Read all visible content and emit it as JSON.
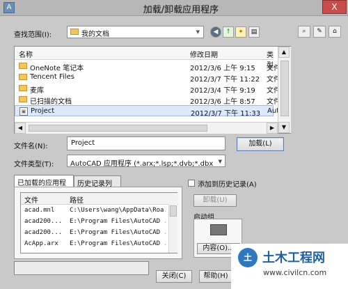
{
  "window": {
    "title": "加载/卸载应用程序",
    "app_icon": "A",
    "close_symbol": "X"
  },
  "search": {
    "label": "查找范围(I):",
    "location": "我的文档"
  },
  "toolbar": {
    "icons": [
      "back-icon",
      "up-folder-icon",
      "new-folder-icon",
      "view-menu-icon",
      "search-icon",
      "tools-icon",
      "help-icon"
    ]
  },
  "file_list": {
    "columns": [
      "名称",
      "修改日期",
      "类型"
    ],
    "items": [
      {
        "name": "OneNote 笔记本",
        "date": "2012/3/6 上午 9:15",
        "type": "文件",
        "icon": "folder"
      },
      {
        "name": "Tencent Files",
        "date": "2012/3/7 下午 11:22",
        "type": "文件",
        "icon": "folder"
      },
      {
        "name": "麦库",
        "date": "2012/3/4 下午 9:19",
        "type": "文件",
        "icon": "folder"
      },
      {
        "name": "已扫描的文档",
        "date": "2012/3/6 上午 8:57",
        "type": "文件",
        "icon": "folder"
      },
      {
        "name": "Project",
        "date": "2012/3/7 下午 11:33",
        "type": "Auto",
        "icon": "file",
        "selected": true
      }
    ]
  },
  "form": {
    "filename_label": "文件名(N):",
    "filename_value": "Project",
    "filetype_label": "文件类型(T):",
    "filetype_value": "AutoCAD 应用程序 (*.arx;*.lsp;*.dvb;*.dbx;*.vlx",
    "load_button": "加载(L)"
  },
  "tabs": {
    "loaded": "已加载的应用程序",
    "history": "历史记录列表"
  },
  "loaded_table": {
    "columns": [
      "文件",
      "路径"
    ],
    "rows": [
      {
        "file": "acad.mnl",
        "path": "C:\\Users\\wang\\AppData\\Roa..."
      },
      {
        "file": "acad200...",
        "path": "E:\\Program Files\\AutoCAD ..."
      },
      {
        "file": "acad200...",
        "path": "E:\\Program Files\\AutoCAD ..."
      },
      {
        "file": "AcApp.arx",
        "path": "E:\\Program Files\\AutoCAD ..."
      }
    ]
  },
  "right_panel": {
    "history_checkbox": "添加到历史记录(A)",
    "unload_button": "卸载(U)",
    "startup_group": "启动组",
    "contents_button": "内容(O)..."
  },
  "footer": {
    "close_button": "关闭(C)",
    "help_button": "帮助(H)"
  },
  "watermark": {
    "logo": "土",
    "main": "土木工程网",
    "sub": "www.civilcn.com"
  }
}
